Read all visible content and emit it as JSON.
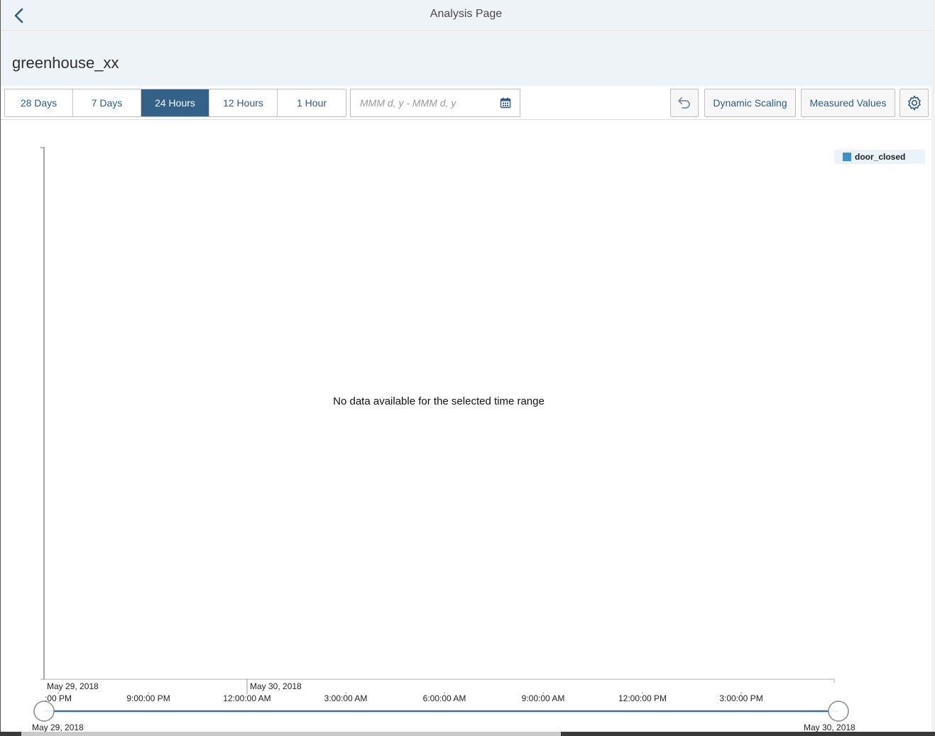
{
  "header": {
    "title": "Analysis Page"
  },
  "object": {
    "title": "greenhouse_xx"
  },
  "toolbar": {
    "ranges": [
      {
        "label": "28 Days",
        "active": false
      },
      {
        "label": "7 Days",
        "active": false
      },
      {
        "label": "24 Hours",
        "active": true
      },
      {
        "label": "12 Hours",
        "active": false
      },
      {
        "label": "1 Hour",
        "active": false
      }
    ],
    "date_range_placeholder": "MMM d, y - MMM d, y",
    "dynamic_scaling_label": "Dynamic Scaling",
    "measured_values_label": "Measured Values",
    "icons": {
      "back": "chevron-left-icon",
      "calendar": "calendar-icon",
      "undo": "undo-icon",
      "settings": "gear-icon"
    }
  },
  "chart": {
    "legend_label": "door_closed",
    "legend_color": "#3d8fd1",
    "no_data_message": "No data available for the selected time range",
    "date_labels": [
      "May 29, 2018",
      "May 30, 2018"
    ],
    "time_labels": [
      ":00 PM",
      "9:00:00 PM",
      "12:00:00 AM",
      "3:00:00 AM",
      "6:00:00 AM",
      "9:00:00 AM",
      "12:00:00 PM",
      "3:00:00 PM"
    ],
    "slider_start_label": "May 29, 2018",
    "slider_end_label": "May 30, 2018"
  },
  "colors": {
    "accent": "#346187",
    "header_bg": "#eef3f7",
    "slider_line": "#3a6f9c"
  }
}
